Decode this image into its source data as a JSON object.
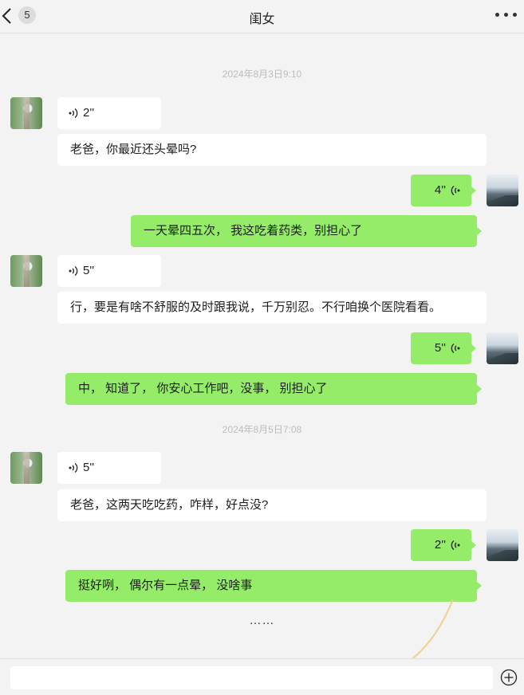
{
  "header": {
    "badge": "5",
    "title": "闺女"
  },
  "timestamps": [
    "2024年8月3日9:10",
    "2024年8月5日7:08"
  ],
  "messages": [
    {
      "side": "in",
      "kind": "voice",
      "duration": "2''"
    },
    {
      "side": "in",
      "kind": "text",
      "text": "老爸，你最近还头晕吗?"
    },
    {
      "side": "out",
      "kind": "voice",
      "duration": "4''"
    },
    {
      "side": "out",
      "kind": "text",
      "text": "一天晕四五次，  我这吃着药类，别担心了"
    },
    {
      "side": "in",
      "kind": "voice",
      "duration": "5''"
    },
    {
      "side": "in",
      "kind": "text",
      "text": "行，要是有啥不舒服的及时跟我说，千万别忍。不行咱换个医院看看。"
    },
    {
      "side": "out",
      "kind": "voice",
      "duration": "5''"
    },
    {
      "side": "out",
      "kind": "text",
      "text": "中，  知道了，  你安心工作吧，没事，  别担心了"
    },
    {
      "side": "in",
      "kind": "voice",
      "duration": "5''"
    },
    {
      "side": "in",
      "kind": "text",
      "text": "老爸，这两天吃吃药，咋样，好点没?"
    },
    {
      "side": "out",
      "kind": "voice",
      "duration": "2''"
    },
    {
      "side": "out",
      "kind": "text",
      "text": "挺好咧，  偶尔有一点晕，  没啥事"
    }
  ],
  "ellipsis": "……",
  "input": {
    "placeholder": "",
    "value": ""
  },
  "icons": {
    "back": "chevron-left-icon",
    "more": "more-dots-icon",
    "voice": "voice-wave-icon",
    "plus": "plus-circle-icon"
  },
  "colors": {
    "background": "#f3f3f3",
    "outgoing_bubble": "#95ec69",
    "incoming_bubble": "#ffffff",
    "timestamp": "#bdbdbd"
  }
}
